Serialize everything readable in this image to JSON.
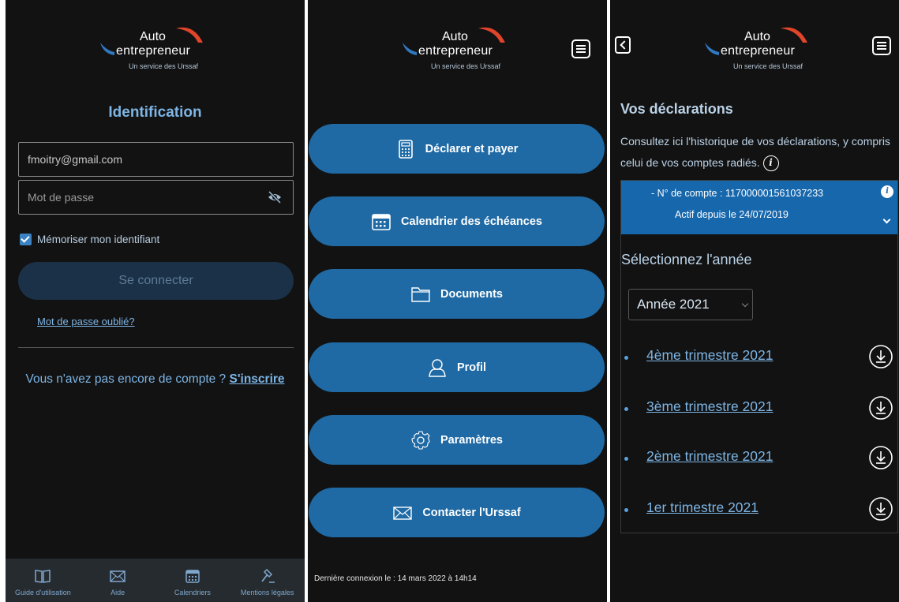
{
  "logo": {
    "auto": "Auto",
    "entrepreneur": "entrepreneur",
    "service": "Un service des Urssaf",
    "colors": {
      "blue": "#2f79c0",
      "red": "#e0442a"
    }
  },
  "login": {
    "title": "Identification",
    "email_value": "fmoitry@gmail.com",
    "password_placeholder": "Mot de passe",
    "remember_label": "Mémoriser mon identifiant",
    "remember_checked": true,
    "connect_button": "Se connecter",
    "forgot_link": "Mot de passe oublié?",
    "no_account_text": "Vous n'avez pas encore de compte ?",
    "signup_link": "S'inscrire",
    "bottom_nav": [
      {
        "label": "Guide d'utilisation",
        "icon": "book-icon"
      },
      {
        "label": "Aide",
        "icon": "envelope-icon"
      },
      {
        "label": "Calendriers",
        "icon": "calendar-icon"
      },
      {
        "label": "Mentions légales",
        "icon": "gavel-icon"
      }
    ]
  },
  "menu": {
    "items": [
      {
        "label": "Déclarer et payer",
        "icon": "calculator-icon"
      },
      {
        "label": "Calendrier des échéances",
        "icon": "calendar-icon"
      },
      {
        "label": "Documents",
        "icon": "folder-icon"
      },
      {
        "label": "Profil",
        "icon": "user-icon"
      },
      {
        "label": "Paramètres",
        "icon": "gear-icon"
      },
      {
        "label": "Contacter l'Urssaf",
        "icon": "envelope-icon"
      }
    ],
    "last_login": "Dernière connexion le : 14 mars 2022 à 14h14",
    "button_color": "#1f6aa5"
  },
  "declarations": {
    "title": "Vos déclarations",
    "description": "Consultez ici l'historique de vos déclarations, y compris celui de vos comptes radiés.",
    "account_number": "- N° de compte : 117000001561037233",
    "active_since": "Actif depuis le 24/07/2019",
    "select_year_label": "Sélectionnez l'année",
    "year_selected": "Année 2021",
    "quarters": [
      {
        "label": "4ème trimestre 2021"
      },
      {
        "label": "3ème trimestre 2021"
      },
      {
        "label": "2ème trimestre 2021"
      },
      {
        "label": "1er trimestre 2021"
      }
    ],
    "header_color": "#1767ad"
  }
}
